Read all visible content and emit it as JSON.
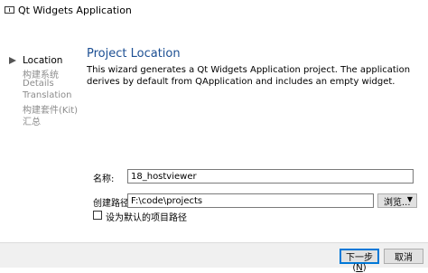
{
  "window": {
    "title": "Qt Widgets Application"
  },
  "sidebar": {
    "items": [
      {
        "label": "Location",
        "active": true
      },
      {
        "label": "构建系统"
      },
      {
        "label": "Details"
      },
      {
        "label": "Translation"
      },
      {
        "label": "构建套件(Kit)"
      },
      {
        "label": "汇总"
      }
    ]
  },
  "main": {
    "title": "Project Location",
    "description": "This wizard generates a Qt Widgets Application project. The application derives by default from QApplication and includes an empty widget."
  },
  "form": {
    "name_label": "名称:",
    "name_value": "18_hostviewer",
    "path_label": "创建路径:",
    "path_value": "F:\\code\\projects",
    "browse_label": "浏览...",
    "browse_caret": "▼",
    "default_checkbox_label": "设为默认的项目路径",
    "default_checked": false
  },
  "footer": {
    "next_label": "下一步(N)",
    "next_text": "下一步(",
    "next_mnemonic": "N",
    "next_suffix": ")",
    "cancel_label": "取消"
  },
  "colors": {
    "title": "#1c4f93",
    "accent": "#0078d7",
    "inactive_text": "#8c8c8c"
  }
}
